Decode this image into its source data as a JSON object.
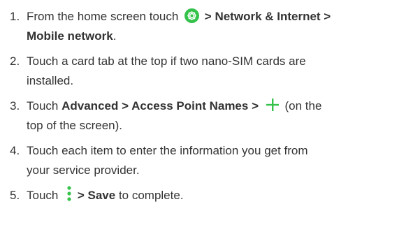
{
  "steps": [
    {
      "number": "1.",
      "line1_prefix": "From the home screen touch",
      "line1_bold": "> Network & Internet >",
      "line2_bold": "Mobile network",
      "line2_suffix": "."
    },
    {
      "number": "2.",
      "line1": "Touch a card tab at the top if two nano-SIM cards are",
      "line2": "installed."
    },
    {
      "number": "3.",
      "line1_prefix": "Touch",
      "line1_bold": "Advanced > Access Point Names >",
      "line1_suffix": "(on the",
      "line2": "top of the screen)."
    },
    {
      "number": "4.",
      "line1": "Touch each item to enter the information you get from",
      "line2": "your service provider."
    },
    {
      "number": "5.",
      "line1_prefix": "Touch",
      "line1_bold": "> Save",
      "line1_suffix": "to complete."
    }
  ],
  "icons": {
    "settings": "gear-icon",
    "add": "plus-icon",
    "more": "menu-icon"
  },
  "colors": {
    "text": "#333333",
    "icon_green": "#34c24a"
  }
}
